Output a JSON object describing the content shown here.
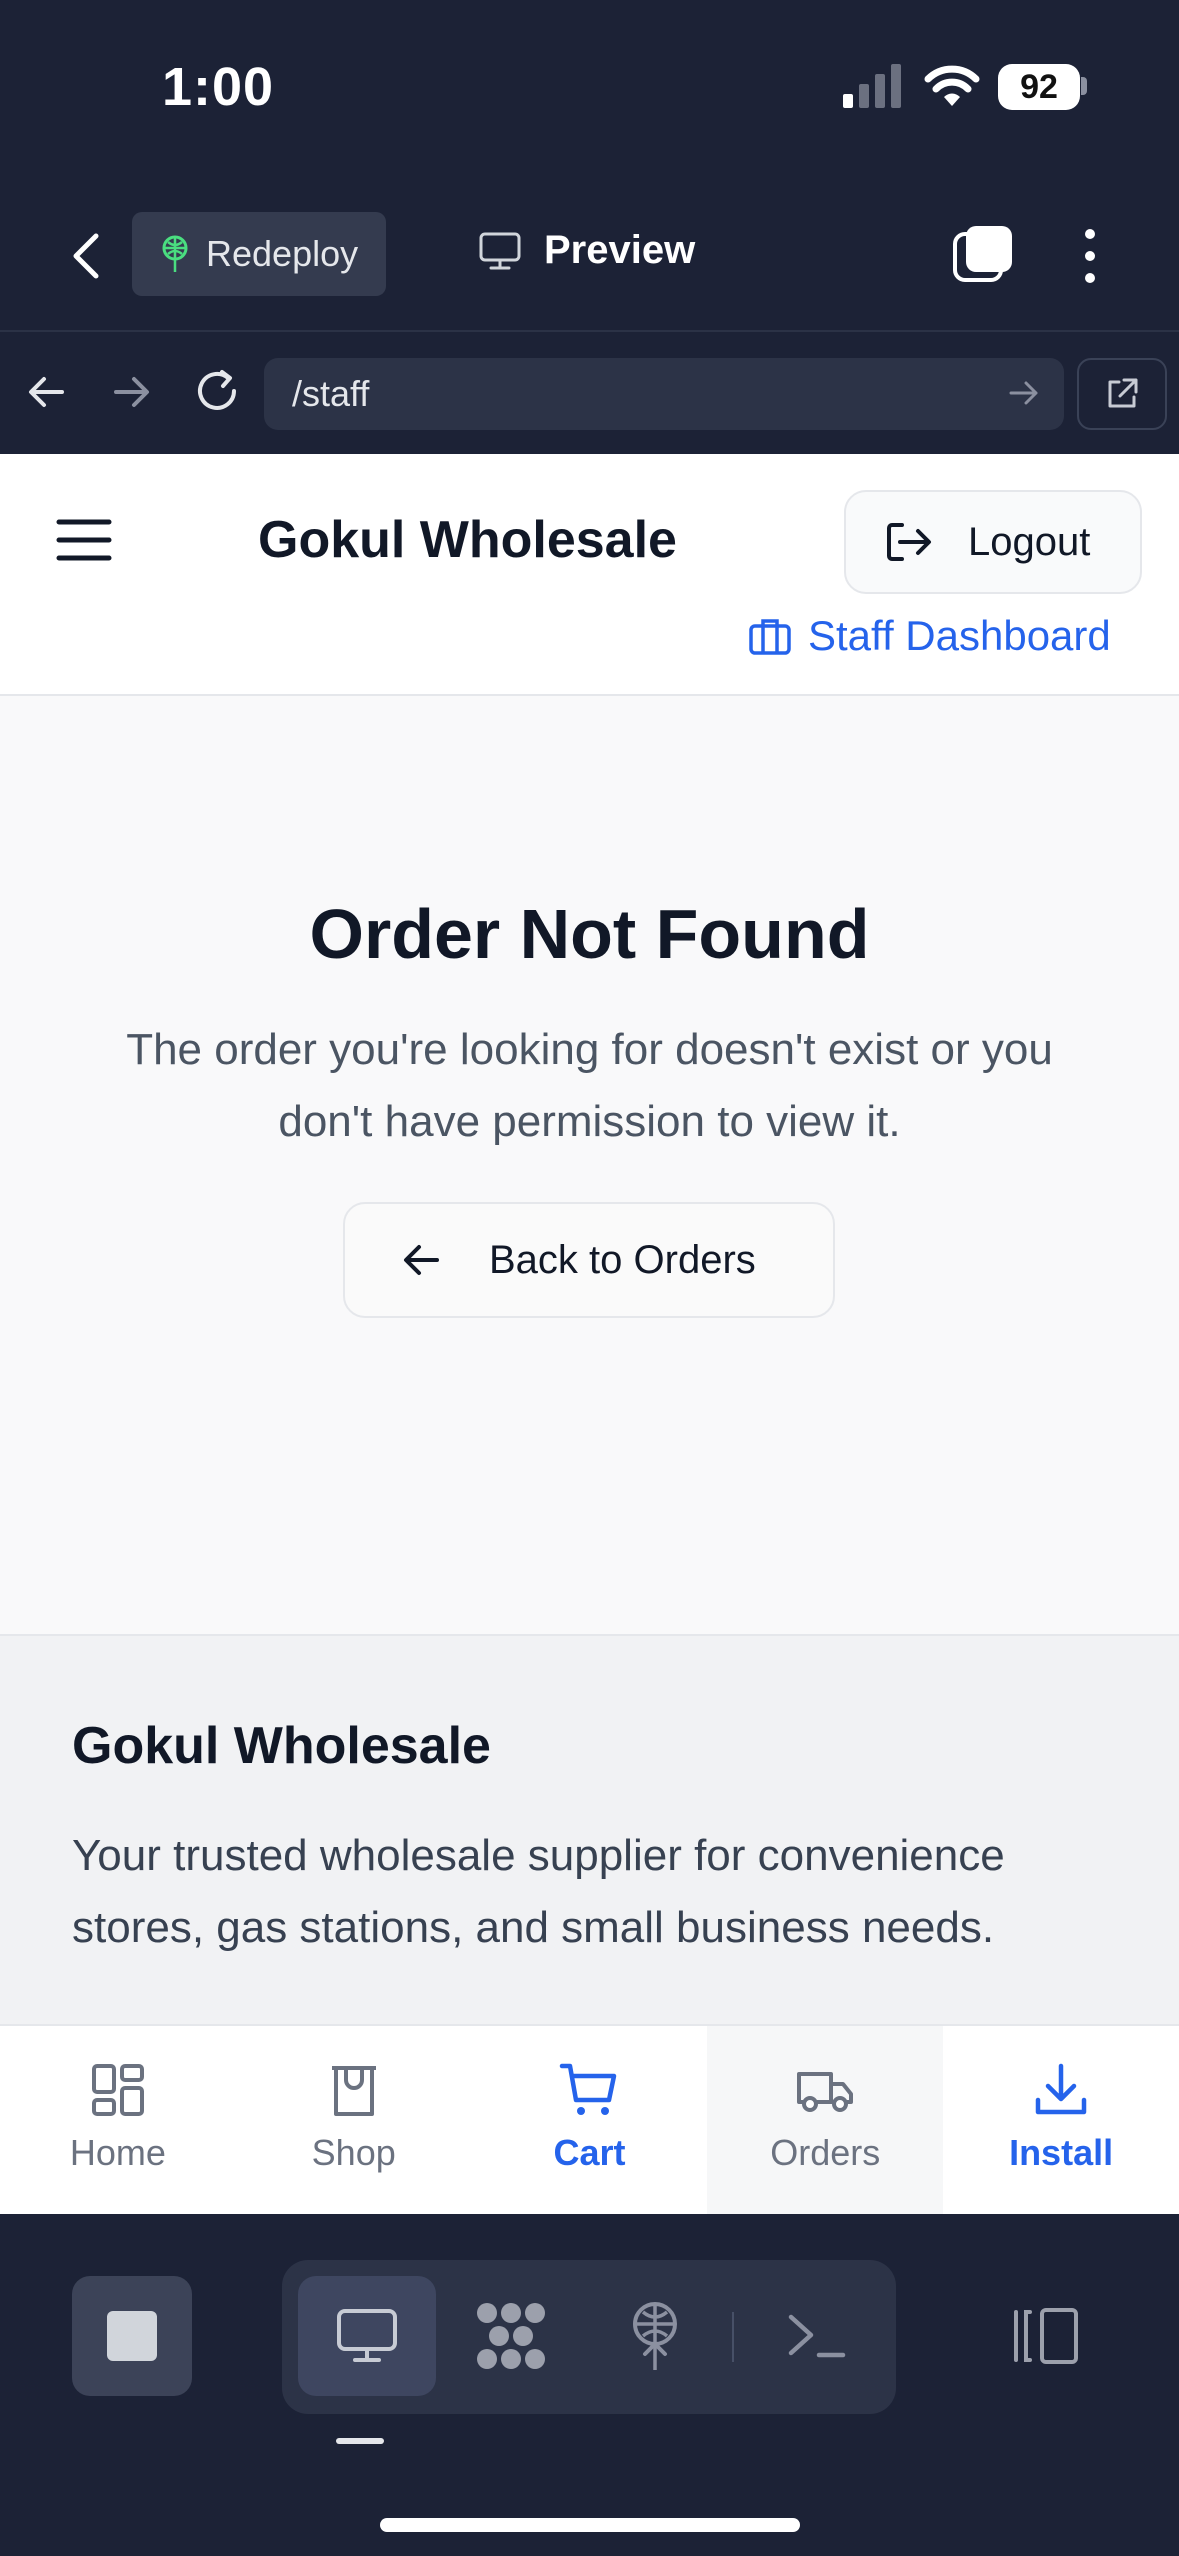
{
  "status_bar": {
    "time": "1:00",
    "battery": "92"
  },
  "editor_bar": {
    "redeploy_label": "Redeploy",
    "preview_label": "Preview"
  },
  "url_bar": {
    "url": "/staff"
  },
  "header": {
    "title": "Gokul Wholesale",
    "logout_label": "Logout",
    "staff_dashboard_label": "Staff Dashboard"
  },
  "main": {
    "title": "Order Not Found",
    "description": "The order you're looking for doesn't exist or you don't have permission to view it.",
    "back_button_label": "Back to Orders"
  },
  "footer": {
    "title": "Gokul Wholesale",
    "text": "Your trusted wholesale supplier for convenience stores, gas stations, and small business needs."
  },
  "bottom_nav": {
    "items": [
      {
        "label": "Home",
        "icon": "grid-icon"
      },
      {
        "label": "Shop",
        "icon": "shop-icon"
      },
      {
        "label": "Cart",
        "icon": "cart-icon",
        "active": true
      },
      {
        "label": "Orders",
        "icon": "truck-icon"
      },
      {
        "label": "Install",
        "icon": "download-icon"
      }
    ]
  },
  "colors": {
    "accent": "#2563eb",
    "dark_chrome": "#1c2236",
    "redeploy_icon": "#4ade80"
  }
}
